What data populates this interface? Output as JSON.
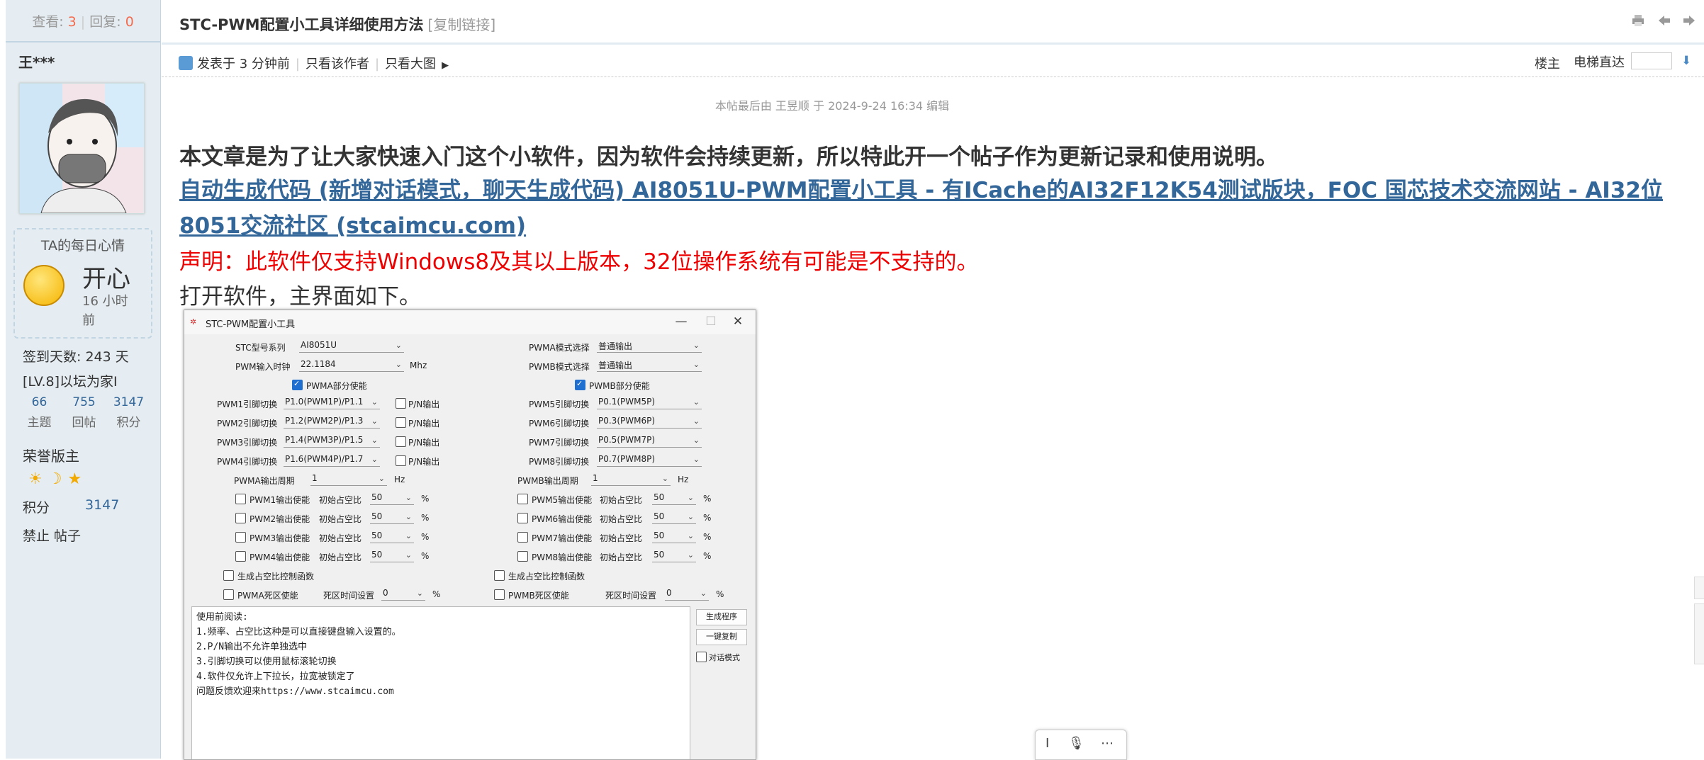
{
  "sidebar": {
    "views_label": "查看:",
    "views": "3",
    "replies_label": "回复:",
    "replies": "0",
    "user_name": "王***",
    "mood_title": "TA的每日心情",
    "mood": "开心",
    "mood_time": "16 小时前",
    "signin": "签到天数: 243 天",
    "level": "[LV.8]以坛为家I",
    "stats": [
      {
        "value": "66",
        "label": "主题"
      },
      {
        "value": "755",
        "label": "回帖"
      },
      {
        "value": "3147",
        "label": "积分"
      }
    ],
    "group": "荣誉版主",
    "medals": "☀☽★",
    "credits_label": "积分",
    "credits": "3147",
    "ban_text": "禁止 帖子"
  },
  "header": {
    "title": "STC-PWM配置小工具详细使用方法",
    "copy_link": "[复制链接]"
  },
  "meta": {
    "posted": "发表于 3 分钟前",
    "only_author": "只看该作者",
    "big_image": "只看大图",
    "floor": "楼主",
    "jump": "电梯直达"
  },
  "edited": "本帖最后由 王昱顺 于 2024-9-24 16:34 编辑",
  "content": {
    "intro": "本文章是为了让大家快速入门这个小软件，因为软件会持续更新，所以特此开一个帖子作为更新记录和使用说明。",
    "link": "自动生成代码 (新增对话模式，聊天生成代码) AI8051U-PWM配置小工具 - 有ICache的AI32F12K54测试版块，FOC 国芯技术交流网站 - AI32位8051交流社区 (stcaimcu.com)",
    "notice": "声明：此软件仅支持Windows8及其以上版本，32位操作系统有可能是不支持的。",
    "open": "打开软件，主界面如下。"
  },
  "tool": {
    "title": "STC-PWM配置小工具",
    "minimize": "—",
    "maximize": "☐",
    "close": "✕",
    "model_label": "STC型号系列",
    "model": "AI8051U",
    "clock_label": "PWM输入时钟",
    "clock": "22.1184",
    "clock_unit": "Mhz",
    "pwma_mode_label": "PWMA模式选择",
    "pwma_mode": "普通输出",
    "pwmb_mode_label": "PWMB模式选择",
    "pwmb_mode": "普通输出",
    "pwma_enable": "PWMA部分使能",
    "pwmb_enable": "PWMB部分使能",
    "pins_a": [
      {
        "label": "PWM1引脚切换",
        "value": "P1.0(PWM1P)/P1.1",
        "pn": "P/N输出"
      },
      {
        "label": "PWM2引脚切换",
        "value": "P1.2(PWM2P)/P1.3",
        "pn": "P/N输出"
      },
      {
        "label": "PWM3引脚切换",
        "value": "P1.4(PWM3P)/P1.5",
        "pn": "P/N输出"
      },
      {
        "label": "PWM4引脚切换",
        "value": "P1.6(PWM4P)/P1.7",
        "pn": "P/N输出"
      }
    ],
    "pins_b": [
      {
        "label": "PWM5引脚切换",
        "value": "P0.1(PWM5P)"
      },
      {
        "label": "PWM6引脚切换",
        "value": "P0.3(PWM6P)"
      },
      {
        "label": "PWM7引脚切换",
        "value": "P0.5(PWM7P)"
      },
      {
        "label": "PWM8引脚切换",
        "value": "P0.7(PWM8P)"
      }
    ],
    "period_a_label": "PWMA输出周期",
    "period_a": "1",
    "period_b_label": "PWMB输出周期",
    "period_b": "1",
    "hz": "Hz",
    "duty_label": "初始占空比",
    "pct": "%",
    "outs_a": [
      {
        "label": "PWM1输出使能",
        "duty": "50"
      },
      {
        "label": "PWM2输出使能",
        "duty": "50"
      },
      {
        "label": "PWM3输出使能",
        "duty": "50"
      },
      {
        "label": "PWM4输出使能",
        "duty": "50"
      }
    ],
    "outs_b": [
      {
        "label": "PWM5输出使能",
        "duty": "50"
      },
      {
        "label": "PWM6输出使能",
        "duty": "50"
      },
      {
        "label": "PWM7输出使能",
        "duty": "50"
      },
      {
        "label": "PWM8输出使能",
        "duty": "50"
      }
    ],
    "gen_duty_a": "生成占空比控制函数",
    "gen_duty_b": "生成占空比控制函数",
    "dead_a": "PWMA死区使能",
    "dead_b": "PWMB死区使能",
    "dead_time_label": "死区时间设置",
    "dead_time_a": "0",
    "dead_time_b": "0",
    "notes": [
      "使用前阅读:",
      "1.频率、占空比这种是可以直接键盘输入设置的。",
      "2.P/N输出不允许单独选中",
      "3.引脚切换可以使用鼠标滚轮切换",
      "4.软件仅允许上下拉长，拉宽被锁定了",
      "问题反馈欢迎来https://www.stcaimcu.com"
    ],
    "btn_generate": "生成程序",
    "btn_copy": "一键复制",
    "dialog_mode": "对话模式"
  },
  "float_bar": {
    "cursor": "I",
    "mic": "🎙",
    "more": "⋯"
  }
}
